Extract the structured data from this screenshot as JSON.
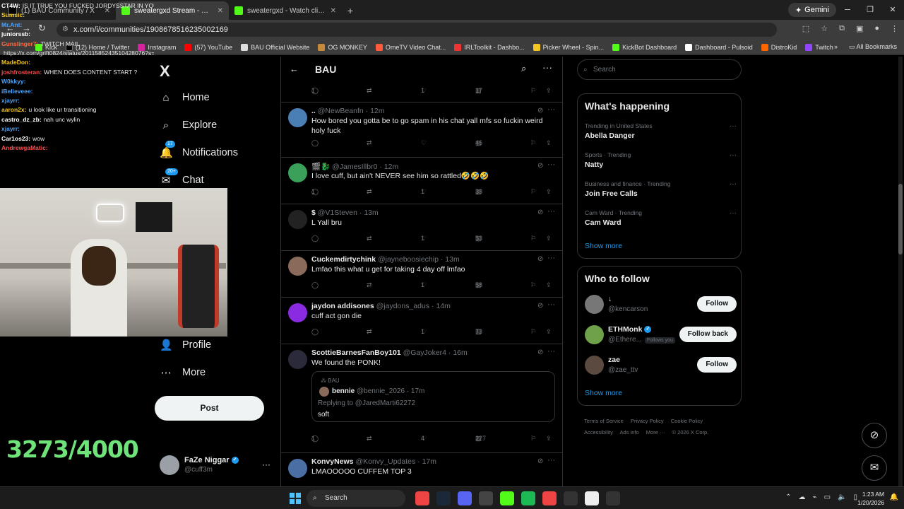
{
  "browser": {
    "tabs": [
      {
        "label": "(1) BAU Community / X"
      },
      {
        "label": "sweatergxd Stream - Watch Live"
      },
      {
        "label": "sweatergxd - Watch clips on Ki"
      }
    ],
    "gemini_label": "Gemini",
    "url": "x.com/i/communities/1908678516235002169",
    "bookmarks": [
      "Kick",
      "(12) Home / Twitter",
      "Instagram",
      "(57) YouTube",
      "BAU Official Website",
      "OG MONKEY",
      "OmeTV Video Chat...",
      "IRLToolkit - Dashbo...",
      "Picker Wheel - Spin...",
      "KickBot Dashboard",
      "Dashboard - Pulsoid",
      "DistroKid",
      "Twitch"
    ],
    "all_bookmarks_label": "All Bookmarks"
  },
  "stream_overlay": {
    "chat": [
      {
        "user": "CT4W:",
        "text": "IS IT TRUE YOU FUCKED JORDYSSTAR IN YOUR SCRAP PACK?",
        "color": "#ffffff"
      },
      {
        "user": "Sumsic:",
        "text": "",
        "color": "#f3c623"
      },
      {
        "user": "Mr.Ant:",
        "text": "",
        "color": "#4aa3ff"
      },
      {
        "user": "juniorssb:",
        "text": "",
        "color": "#ffffff"
      },
      {
        "user": "Gunslinger7:",
        "text": "TWITCH MAIL",
        "color": "#ff6a3d"
      },
      {
        "user": "",
        "text": "https://x.com/grift0824/status/2011585243510428076?s=46",
        "color": "#ffffff"
      },
      {
        "user": "MadeDon:",
        "text": "",
        "color": "#f3c623"
      },
      {
        "user": "joshfrosteran:",
        "text": "WHEN DOES CONTENT START ?",
        "color": "#ff4d4d"
      },
      {
        "user": "W0kkyy:",
        "text": "",
        "color": "#4aa3ff"
      },
      {
        "user": "iBelieveee:",
        "text": "",
        "color": "#4aa3ff"
      },
      {
        "user": "xjayrr:",
        "text": "",
        "color": "#4aa3ff"
      },
      {
        "user": "aaron2x:",
        "text": "u look like ur transitioning",
        "color": "#f3c623"
      },
      {
        "user": "castro_dz_zb:",
        "text": "nah unc wylin",
        "color": "#ffffff"
      },
      {
        "user": "xjayrr:",
        "text": "",
        "color": "#4aa3ff"
      },
      {
        "user": "Car1os23:",
        "text": "wow",
        "color": "#ffffff"
      },
      {
        "user": "AndrewgaMatic:",
        "text": "",
        "color": "#ff4d4d"
      }
    ],
    "goal_counter": "3273/4000"
  },
  "x_nav": {
    "logo": "X",
    "items": [
      {
        "label": "Home",
        "icon": "home-icon",
        "glyph": "⌂"
      },
      {
        "label": "Explore",
        "icon": "search-icon",
        "glyph": "⌕"
      },
      {
        "label": "Notifications",
        "icon": "bell-icon",
        "glyph": "♫",
        "badge": "17"
      },
      {
        "label": "Chat",
        "icon": "chat-icon",
        "glyph": "✉",
        "badge": "20+"
      },
      {
        "label": "Profile",
        "icon": "profile-icon",
        "glyph": "👤"
      },
      {
        "label": "More",
        "icon": "more-icon",
        "glyph": "⋯"
      }
    ],
    "post_label": "Post",
    "account": {
      "name": "FaZe Niggar",
      "handle": "@cuff3m"
    }
  },
  "timeline": {
    "title": "BAU",
    "top_actions": {
      "replies": "1",
      "likes": "1",
      "views": "17"
    },
    "tweets": [
      {
        "name": "..",
        "handle": "@NewBeanfn",
        "time": "12m",
        "text": "How bored you gotta be to go spam in his chat yall mfs so fuckin weird holy fuck",
        "replies": "",
        "likes": "",
        "views": "46",
        "avatar_color": "#4a7fb5"
      },
      {
        "name": "🎬🐉",
        "handle": "@JamesIllbr0",
        "time": "12m",
        "text": "I love cuff, but ain't NEVER see him so rattled🤣🤣🤣",
        "replies": "1",
        "likes": "1",
        "views": "38",
        "avatar_color": "#3aa05a"
      },
      {
        "name": "$",
        "handle": "@V1Steven",
        "time": "13m",
        "text": "L Yall bru",
        "replies": "",
        "likes": "1",
        "views": "53",
        "avatar_color": "#222222"
      },
      {
        "name": "Cuckemdirtychink",
        "handle": "@jayneboosiechip",
        "time": "13m",
        "text": "Lmfao this what u get for taking 4 day off lmfao",
        "replies": "",
        "likes": "1",
        "views": "58",
        "avatar_color": "#8a6a5a"
      },
      {
        "name": "jaydon addisones",
        "handle": "@jaydons_adus",
        "time": "14m",
        "text": "cuff act gon die",
        "replies": "",
        "likes": "1",
        "views": "73",
        "avatar_color": "#8a2be2"
      },
      {
        "name": "ScottieBarnesFanBoy101",
        "handle": "@GayJoker4",
        "time": "16m",
        "text": "We found the PONK!",
        "replies": "1",
        "likes": "4",
        "views": "227",
        "avatar_color": "#2a2a3a",
        "quote": {
          "community": "BAU",
          "name": "bennie",
          "handle": "@bennie_2026",
          "time": "17m",
          "replying_to": "Replying to @JaredMarti62272",
          "text": "soft"
        }
      },
      {
        "name": "KonvyNews",
        "handle": "@Konvy_Updates",
        "time": "17m",
        "text": "LMAOOOOO CUFFEM TOP 3",
        "replies": "",
        "likes": "",
        "views": "",
        "avatar_color": "#4a6fa5"
      }
    ]
  },
  "sidebar": {
    "search_placeholder": "Search",
    "happening": {
      "title": "What's happening",
      "trends": [
        {
          "context": "Trending in United States",
          "name": "Abella Danger"
        },
        {
          "context": "Sports · Trending",
          "name": "Natty"
        },
        {
          "context": "Business and finance · Trending",
          "name": "Join Free Calls"
        },
        {
          "context": "Cam Ward · Trending",
          "name": "Cam Ward"
        }
      ],
      "show_more": "Show more"
    },
    "who_to_follow": {
      "title": "Who to follow",
      "accounts": [
        {
          "name": "↓",
          "handle": "@kencarson",
          "button": "Follow",
          "follows_you": ""
        },
        {
          "name": "ETHMonk",
          "handle": "@Ethere...",
          "button": "Follow back",
          "follows_you": "Follows you"
        },
        {
          "name": "zae",
          "handle": "@zae_ttv",
          "button": "Follow",
          "follows_you": ""
        }
      ],
      "show_more": "Show more"
    },
    "footer": [
      "Terms of Service",
      "Privacy Policy",
      "Cookie Policy",
      "Accessibility",
      "Ads info",
      "More ···",
      "© 2026 X Corp."
    ]
  },
  "taskbar": {
    "search_label": "Search",
    "time": "1:23 AM",
    "date": "1/20/2026"
  },
  "colors": {
    "accent": "#1d9bf0",
    "goal": "#6fe37a",
    "kick": "#53fc18"
  }
}
